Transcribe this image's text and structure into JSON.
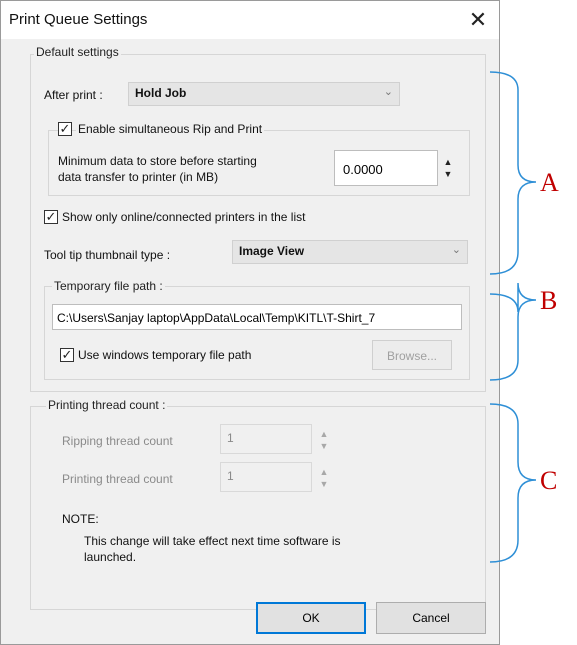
{
  "window": {
    "title": "Print Queue Settings",
    "close_icon": "close-icon"
  },
  "default_settings": {
    "group_label": "Default settings",
    "after_print": {
      "label": "After print :",
      "value": "Hold Job"
    },
    "simultaneous": {
      "label": "Enable simultaneous Rip and Print",
      "checked": true
    },
    "min_data": {
      "label_line1": "Minimum data to store before starting",
      "label_line2": "data transfer to printer (in MB)",
      "value": "0.0000"
    },
    "show_online": {
      "label": "Show only online/connected printers in the list",
      "checked": true
    },
    "tooltip": {
      "label": "Tool tip thumbnail type :",
      "value": "Image View"
    },
    "temp_path": {
      "group_label": "Temporary file path :",
      "value": "C:\\Users\\Sanjay laptop\\AppData\\Local\\Temp\\KITL\\T-Shirt_7",
      "use_windows": {
        "label": "Use windows temporary file path",
        "checked": true
      },
      "browse_label": "Browse..."
    }
  },
  "thread_count": {
    "group_label": "Printing thread count :",
    "ripping": {
      "label": "Ripping thread count",
      "value": "1"
    },
    "printing": {
      "label": "Printing thread count",
      "value": "1"
    },
    "note_title": "NOTE:",
    "note_line1": "This change will take effect next time software is",
    "note_line2": "launched."
  },
  "buttons": {
    "ok": "OK",
    "cancel": "Cancel"
  },
  "annotations": {
    "a": "A",
    "b": "B",
    "c": "C"
  },
  "colors": {
    "annotation_text": "#c00000",
    "bracket": "#2e8fd6",
    "ok_border": "#0078d7"
  }
}
